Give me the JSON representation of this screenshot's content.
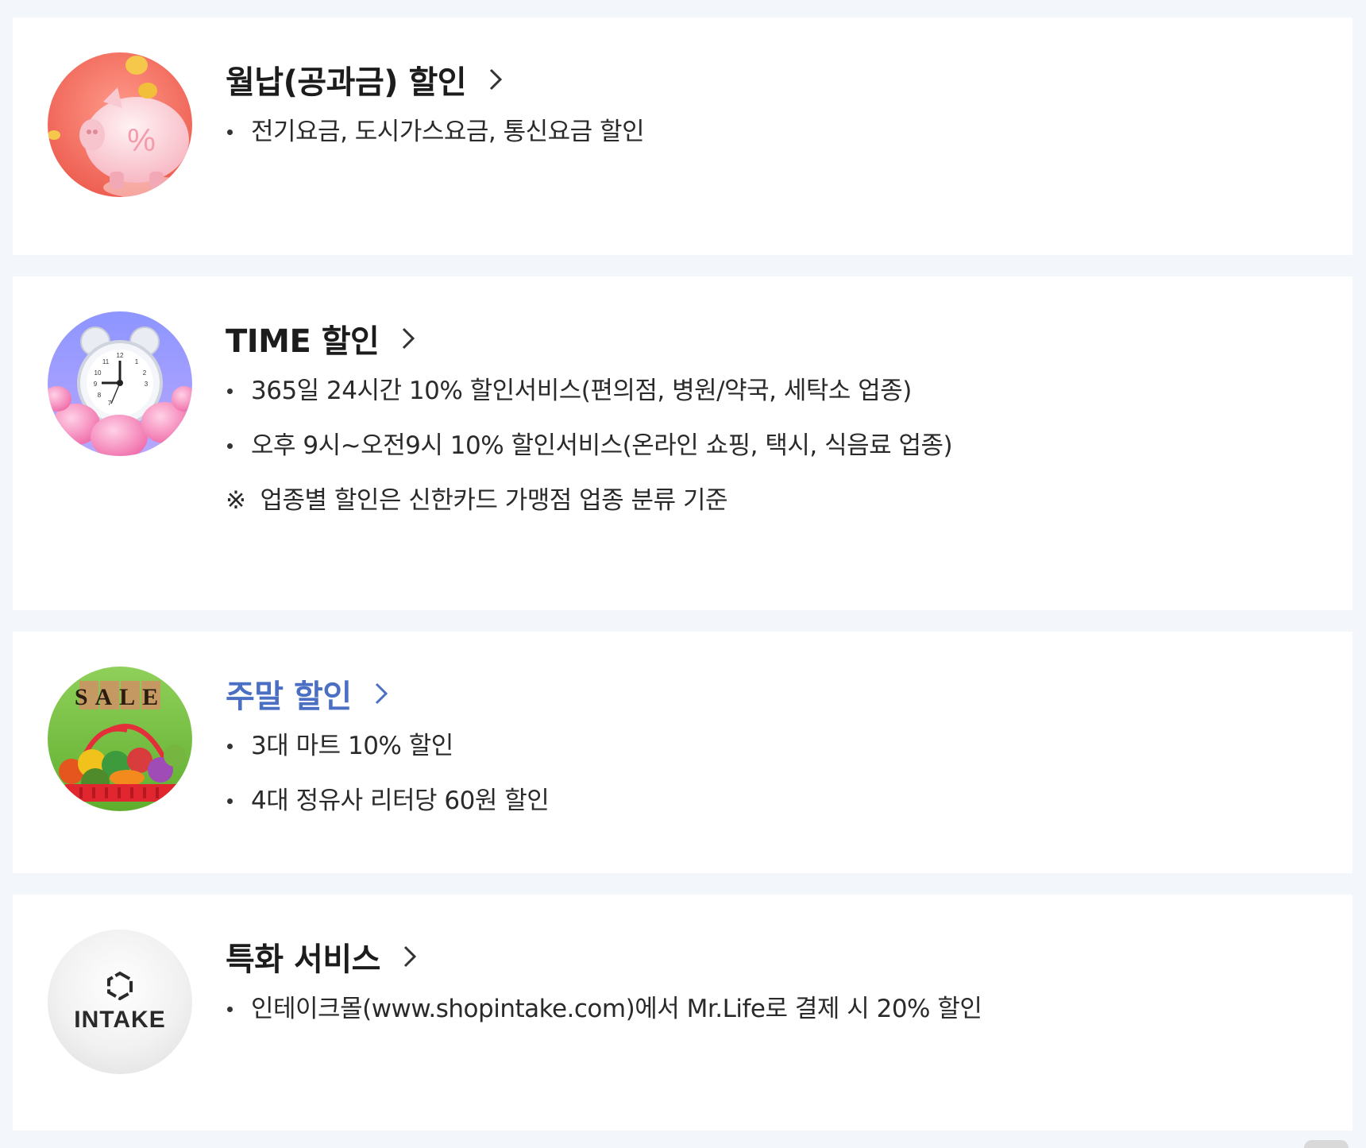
{
  "colors": {
    "page_bg": "#f3f6fa",
    "card_bg": "#ffffff",
    "title_text": "#1c1c1c",
    "accent_blue": "#4a6fc3",
    "body_text": "#2a2a2a"
  },
  "sections": [
    {
      "title": "월납(공과금) 할인",
      "icon": "piggy-bank-percent-icon",
      "bullets": [
        "전기요금, 도시가스요금, 통신요금 할인"
      ]
    },
    {
      "title": "TIME 할인",
      "icon": "alarm-clock-icon",
      "bullets": [
        "365일 24시간 10% 할인서비스(편의점, 병원/약국, 세탁소 업종)",
        "오후 9시~오전9시 10% 할인서비스(온라인 쇼핑, 택시, 식음료 업종)"
      ],
      "note_mark": "※",
      "note": "업종별 할인은 신한카드 가맹점 업종 분류 기준"
    },
    {
      "title": "주말 할인",
      "icon": "sale-basket-icon",
      "sale_sign": "SALE",
      "bullets": [
        "3대 마트 10% 할인",
        "4대 정유사 리터당 60원 할인"
      ]
    },
    {
      "title": "특화 서비스",
      "icon": "intake-logo-icon",
      "logo_text": "INTAKE",
      "bullets": [
        "인테이크몰(www.shopintake.com)에서 Mr.Life로 결제 시 20% 할인"
      ]
    }
  ]
}
